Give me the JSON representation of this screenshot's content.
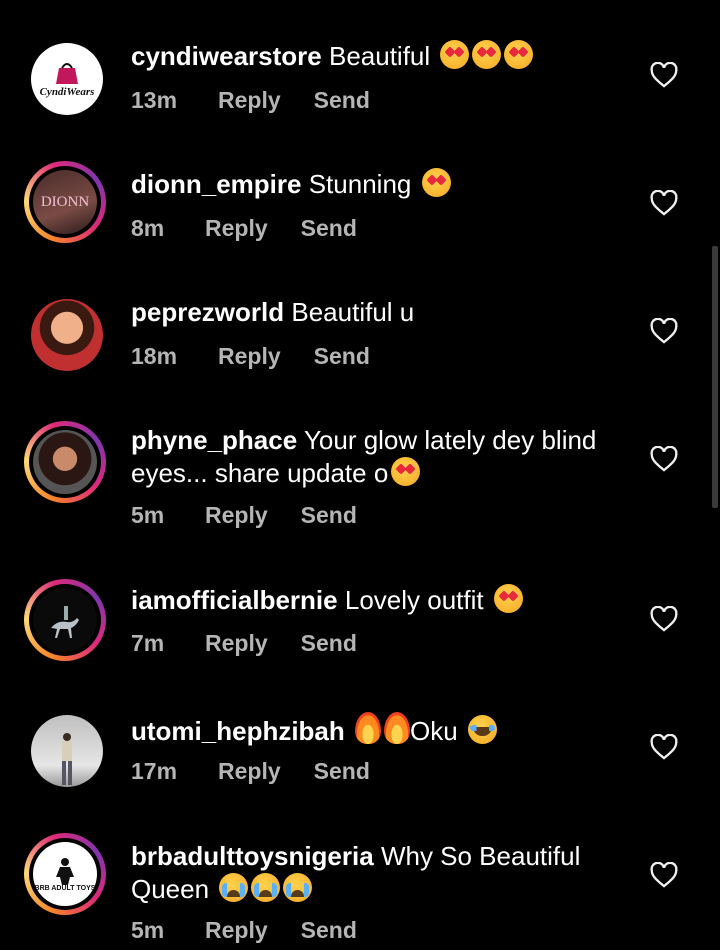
{
  "comments": [
    {
      "username": "cyndiwearstore",
      "text": "Beautiful",
      "emoji": [
        "heart-eyes",
        "heart-eyes",
        "heart-eyes"
      ],
      "time": "13m",
      "reply": "Reply",
      "send": "Send",
      "avatar_text": "CyndiWears",
      "ring": false
    },
    {
      "username": "dionn_empire",
      "text": "Stunning",
      "emoji": [
        "heart-eyes"
      ],
      "time": "8m",
      "reply": "Reply",
      "send": "Send",
      "avatar_text": "DIONN",
      "ring": true
    },
    {
      "username": "peprezworld",
      "text": "Beautiful u",
      "emoji": [],
      "time": "18m",
      "reply": "Reply",
      "send": "Send",
      "ring": false
    },
    {
      "username": "phyne_phace",
      "text": "Your glow lately dey blind",
      "text2": "eyes... share update o",
      "emoji2": [
        "heart-eyes"
      ],
      "time": "5m",
      "reply": "Reply",
      "send": "Send",
      "ring": true
    },
    {
      "username": "iamofficialbernie",
      "text": "Lovely outfit",
      "emoji": [
        "heart-eyes"
      ],
      "time": "7m",
      "reply": "Reply",
      "send": "Send",
      "ring": true
    },
    {
      "username": "utomi_hephzibah",
      "emoji_pre": [
        "fire",
        "fire"
      ],
      "text": "Oku",
      "emoji": [
        "tears"
      ],
      "time": "17m",
      "reply": "Reply",
      "send": "Send",
      "ring": false
    },
    {
      "username": "brbadulttoysnigeria",
      "text": "Why So Beautiful",
      "text2": "Queen",
      "emoji2": [
        "crying",
        "crying",
        "crying"
      ],
      "time": "5m",
      "reply": "Reply",
      "send": "Send",
      "avatar_text": "BRB ADULT TOYS",
      "ring": true
    }
  ],
  "colors": {
    "background": "#000000",
    "text": "#ffffff",
    "meta": "#b5b5b5"
  },
  "icons": {
    "like": "heart-outline-icon"
  }
}
